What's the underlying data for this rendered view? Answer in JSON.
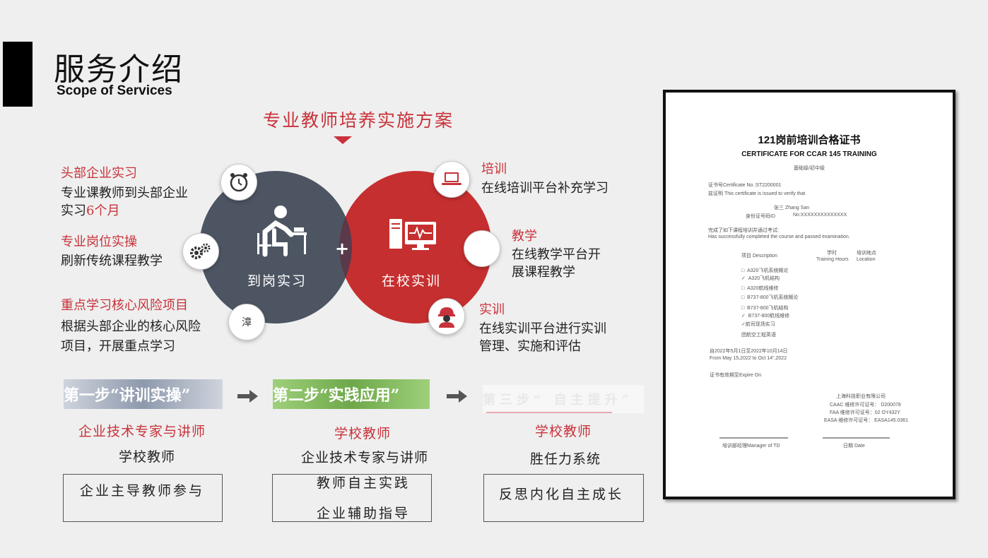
{
  "header": {
    "title_cn": "服务介绍",
    "title_en": "Scope of Services"
  },
  "plan": {
    "title": "专业教师培养实施方案"
  },
  "venn": {
    "left_label": "到岗实习",
    "right_label": "在校实训",
    "plus": "+"
  },
  "left_items": [
    {
      "title": "头部企业实习",
      "line1": "专业课教师到头部企业",
      "line2_a": "实习",
      "line2_b": "6个月"
    },
    {
      "title": "专业岗位实操",
      "line1": "刷新传统课程教学"
    },
    {
      "title": "重点学习核心风险项目",
      "line1": "根据头部企业的核心风险",
      "line2": "项目，开展重点学习",
      "icon_text": "漳"
    }
  ],
  "right_items": [
    {
      "title": "培训",
      "line1": "在线培训平台补充学习"
    },
    {
      "title": "教学",
      "line1": "在线教学平台开",
      "line2": "展课程教学"
    },
    {
      "title": "实训",
      "line1": "在线实训平台进行实训",
      "line2": "管理、实施和评估"
    }
  ],
  "steps": [
    {
      "label": "第一步“讲训实操”",
      "red": "企业技术专家与讲师",
      "line": "学校教师",
      "box": [
        "企业主导教师参与"
      ]
    },
    {
      "label": "第二步“实践应用”",
      "red": "学校教师",
      "line": "企业技术专家与讲师",
      "box": [
        "教师自主实践",
        "企业辅助指导"
      ]
    },
    {
      "label": "第三步“ 自主提升”",
      "red": "学校教师",
      "line": "胜任力系统",
      "box": [
        "反思内化自主成长"
      ]
    }
  ],
  "certificate": {
    "title": "121岗前培训合格证书",
    "subtitle": "CERTIFICATE FOR CCAR 145 TRAINING",
    "type": "基础级/初中级",
    "cert_no": "证书号Certificate No.:ST2200001",
    "issued": "兹证明 This certificate is issued to verify that",
    "name": "张三 Zhang San",
    "id_label": "身份证号码ID",
    "id_no": "No:XXXXXXXXXXXXXX",
    "completed_cn": "完成了如下课程培训并通过考试:",
    "completed_en": "Has successfully completed the course and passed examination.",
    "col_item": "项目 Description",
    "col_hours_cn": "学时",
    "col_hours_en": "Training  Hours",
    "col_loc_cn": "培训地点",
    "col_loc_en": "Location",
    "courses": [
      {
        "mark": "□",
        "name": "A320飞机系统概论"
      },
      {
        "mark": "✓",
        "name": "A320飞机结构"
      },
      {
        "mark": "□",
        "name": "A320航线维修"
      },
      {
        "mark": "□",
        "name": "B737-800飞机系统概论"
      },
      {
        "mark": "□",
        "name": "B737-800飞机结构"
      },
      {
        "mark": "✓",
        "name": "B737-800航线维修"
      },
      {
        "mark": "✓",
        "name": "航司现场实习"
      },
      {
        "mark": "",
        "name": "团航空工程英语"
      }
    ],
    "date_cn": "自2022年5月1日至2022年10月14日",
    "date_en": "From  May  15,2022  to  Oct  14\",2022",
    "expire": "证书有效期至Expire  On",
    "company": "上海科技职业有限公司",
    "caac": "CAAC   维修许可证号： D200078",
    "faa": "FAA  维修许可证号：02  OY432Y",
    "easa": "EASA   维修许可证号： EASA145.0361",
    "manager": "培训部经理Manager of TD",
    "date_label": "日期 Date"
  }
}
